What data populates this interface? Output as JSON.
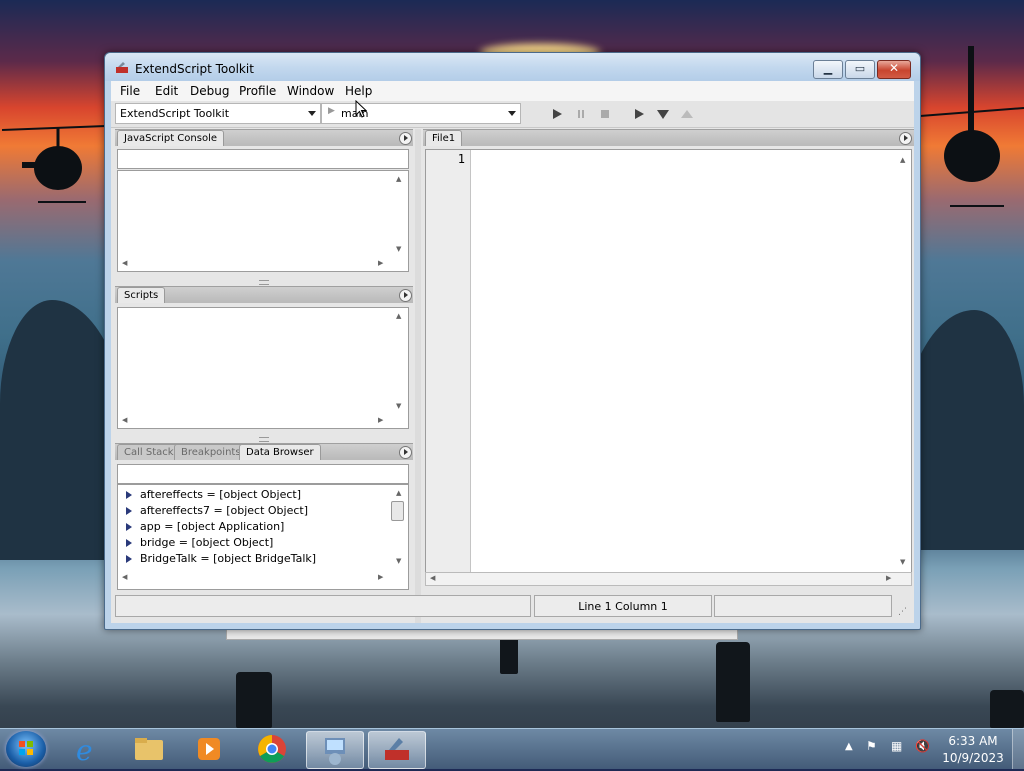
{
  "window": {
    "title": "ExtendScript Toolkit"
  },
  "menu": [
    "File",
    "Edit",
    "Debug",
    "Profile",
    "Window",
    "Help"
  ],
  "toolbar": {
    "target_app": "ExtendScript Toolkit",
    "engine": "main"
  },
  "panels": {
    "console": {
      "title": "JavaScript Console"
    },
    "scripts": {
      "title": "Scripts"
    },
    "debug_tabs": [
      "Call Stack",
      "Breakpoints",
      "Data Browser"
    ],
    "data_browser": [
      "aftereffects = [object Object]",
      "aftereffects7 = [object Object]",
      "app = [object Application]",
      "bridge = [object Object]",
      "BridgeTalk = [object BridgeTalk]"
    ]
  },
  "editor": {
    "tab": "File1",
    "lines": [
      "1"
    ]
  },
  "status": {
    "position": "Line 1 Column 1"
  },
  "tray": {
    "time": "6:33 AM",
    "date": "10/9/2023"
  },
  "colors": {
    "title_bar": "#c3d8ee",
    "panel_bg": "#e6e6e6",
    "close_red": "#c8452f"
  }
}
